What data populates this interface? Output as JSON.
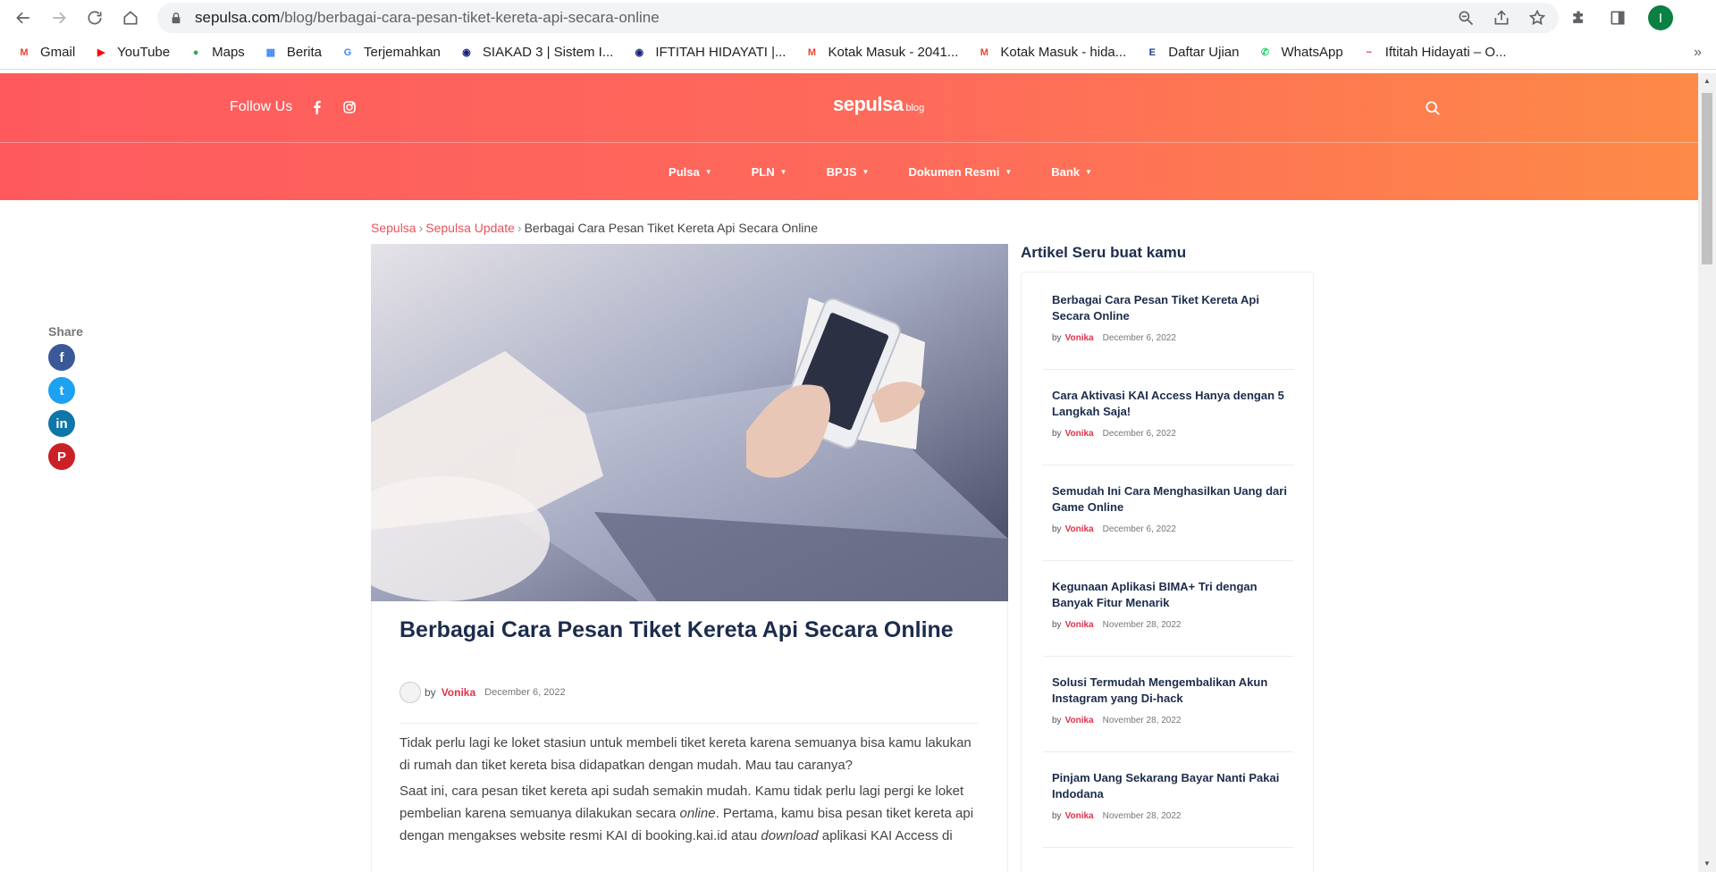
{
  "browser": {
    "url_domain": "sepulsa.com",
    "url_path": "/blog/berbagai-cara-pesan-tiket-kereta-api-secara-online",
    "profile_initial": "I"
  },
  "bookmarks": [
    {
      "label": "Gmail",
      "icon": "gmail-icon",
      "color": "#ea4335"
    },
    {
      "label": "YouTube",
      "icon": "youtube-icon",
      "color": "#ff0000"
    },
    {
      "label": "Maps",
      "icon": "maps-icon",
      "color": "#34a853"
    },
    {
      "label": "Berita",
      "icon": "news-icon",
      "color": "#4285f4"
    },
    {
      "label": "Terjemahkan",
      "icon": "translate-icon",
      "color": "#4285f4"
    },
    {
      "label": "SIAKAD 3 | Sistem I...",
      "icon": "university-icon",
      "color": "#1a237e"
    },
    {
      "label": "IFTITAH HIDAYATI |...",
      "icon": "university-icon",
      "color": "#1a237e"
    },
    {
      "label": "Kotak Masuk - 2041...",
      "icon": "gmail-icon",
      "color": "#ea4335"
    },
    {
      "label": "Kotak Masuk - hida...",
      "icon": "gmail-icon",
      "color": "#ea4335"
    },
    {
      "label": "Daftar Ujian",
      "icon": "exam-icon",
      "color": "#1a3d8f"
    },
    {
      "label": "WhatsApp",
      "icon": "whatsapp-icon",
      "color": "#25d366"
    },
    {
      "label": "Iftitah Hidayati – O...",
      "icon": "site-icon",
      "color": "#e0324b"
    }
  ],
  "header": {
    "follow_label": "Follow Us",
    "logo_main": "sepulsa",
    "logo_sub": "blog",
    "menu": [
      "Pulsa",
      "PLN",
      "BPJS",
      "Dokumen Resmi",
      "Bank"
    ]
  },
  "breadcrumb": {
    "home": "Sepulsa",
    "category": "Sepulsa Update",
    "current": "Berbagai Cara Pesan Tiket Kereta Api Secara Online",
    "separator": "›"
  },
  "share": {
    "label": "Share",
    "buttons": [
      {
        "name": "facebook",
        "glyph": "f",
        "color": "#3b5998"
      },
      {
        "name": "twitter",
        "glyph": "t",
        "color": "#1da1f2"
      },
      {
        "name": "linkedin",
        "glyph": "in",
        "color": "#0e76a8"
      },
      {
        "name": "pinterest",
        "glyph": "P",
        "color": "#cb2027"
      }
    ]
  },
  "article": {
    "title": "Berbagai Cara Pesan Tiket Kereta Api Secara Online",
    "by": "by",
    "author": "Vonika",
    "date": "December 6, 2022",
    "para1": "Tidak perlu lagi ke loket stasiun untuk membeli tiket kereta karena semuanya bisa kamu lakukan di rumah dan tiket kereta bisa didapatkan dengan mudah. Mau tau caranya?",
    "para2_a": "Saat ini, cara pesan tiket kereta api sudah semakin mudah. Kamu tidak perlu lagi pergi ke loket pembelian karena semuanya dilakukan secara ",
    "para2_em1": "online",
    "para2_b": ". Pertama, kamu bisa pesan tiket kereta api dengan mengakses website resmi KAI di booking.kai.id atau ",
    "para2_em2": "download",
    "para2_c": " aplikasi KAI Access di"
  },
  "sidebar": {
    "title": "Artikel Seru buat kamu",
    "by": "by",
    "items": [
      {
        "title": "Berbagai Cara Pesan Tiket Kereta Api Secara Online",
        "author": "Vonika",
        "date": "December 6, 2022"
      },
      {
        "title": "Cara Aktivasi KAI Access Hanya dengan 5 Langkah Saja!",
        "author": "Vonika",
        "date": "December 6, 2022"
      },
      {
        "title": "Semudah Ini Cara Menghasilkan Uang dari Game Online",
        "author": "Vonika",
        "date": "December 6, 2022"
      },
      {
        "title": "Kegunaan Aplikasi BIMA+ Tri dengan Banyak Fitur Menarik",
        "author": "Vonika",
        "date": "November 28, 2022"
      },
      {
        "title": "Solusi Termudah Mengembalikan Akun Instagram yang Di-hack",
        "author": "Vonika",
        "date": "November 28, 2022"
      },
      {
        "title": "Pinjam Uang Sekarang Bayar Nanti Pakai Indodana",
        "author": "Vonika",
        "date": "November 28, 2022"
      }
    ]
  }
}
